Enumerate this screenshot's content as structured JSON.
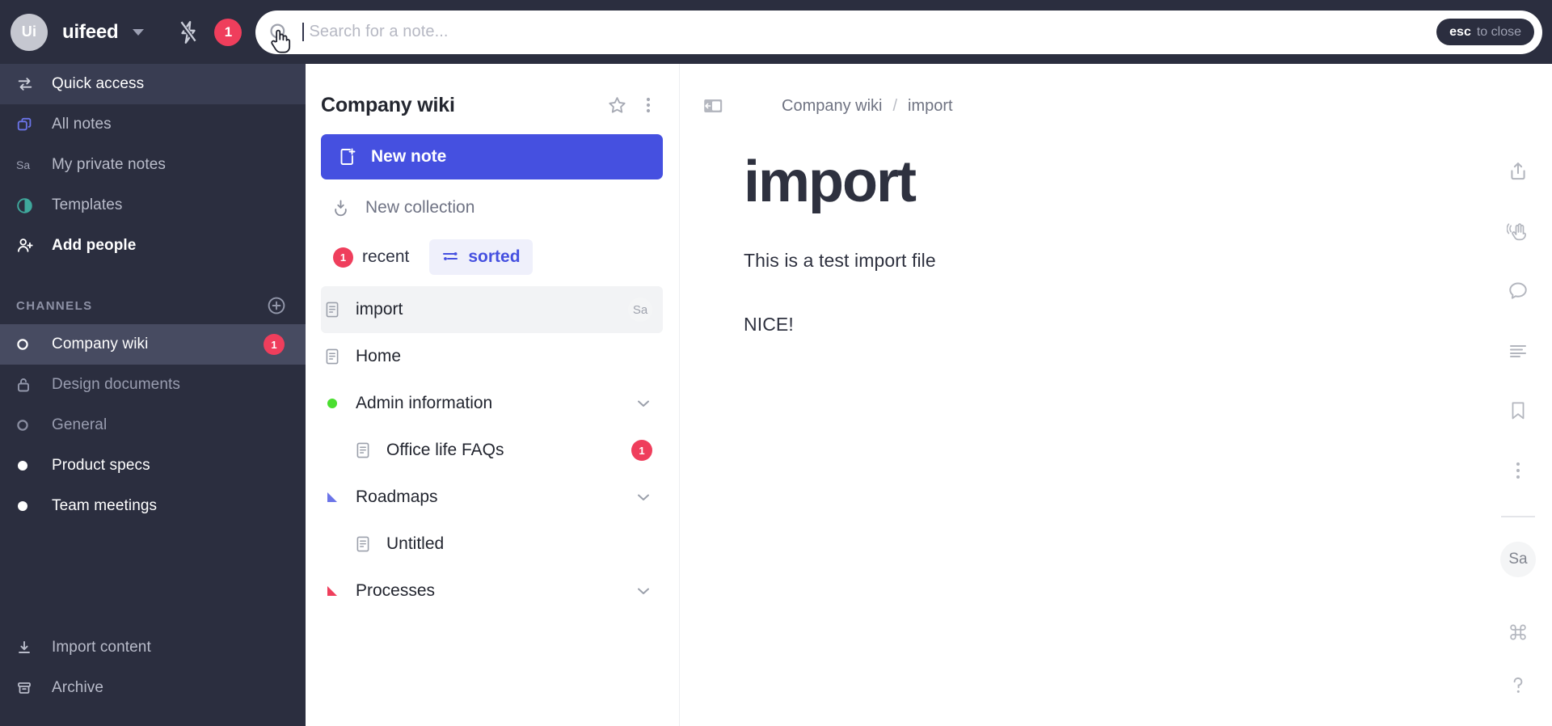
{
  "topbar": {
    "avatar_initials": "Ui",
    "workspace": "uifeed",
    "notification_count": "1",
    "search_placeholder": "Search for a note...",
    "esc_key": "esc",
    "esc_text": "to close",
    "icons": {
      "bolt": "bolt-icon",
      "caret": "chevron-down-icon",
      "search": "search-icon"
    }
  },
  "sidebar": {
    "quick": [
      {
        "label": "Quick access",
        "icon": "swap-arrows-icon",
        "active": true
      },
      {
        "label": "All notes",
        "icon": "layers-icon",
        "active": false
      },
      {
        "label": "My private notes",
        "icon": "avatar-sa-icon",
        "active": false
      },
      {
        "label": "Templates",
        "icon": "template-circle-icon",
        "active": false
      },
      {
        "label": "Add people",
        "icon": "person-add-icon",
        "active": false
      }
    ],
    "channels_header": "CHANNELS",
    "add_channel_icon": "plus-circle-icon",
    "channels": [
      {
        "label": "Company wiki",
        "icon": "circle-outline-icon",
        "active": true,
        "badge": "1"
      },
      {
        "label": "Design documents",
        "icon": "lock-icon",
        "active": false,
        "badge": ""
      },
      {
        "label": "General",
        "icon": "circle-outline-icon",
        "active": false,
        "badge": ""
      },
      {
        "label": "Product specs",
        "icon": "dot-filled-icon",
        "active": false,
        "badge": ""
      },
      {
        "label": "Team meetings",
        "icon": "dot-filled-icon",
        "active": false,
        "badge": ""
      }
    ],
    "bottom": [
      {
        "label": "Import content",
        "icon": "download-icon"
      },
      {
        "label": "Archive",
        "icon": "archive-icon"
      }
    ]
  },
  "midpanel": {
    "title": "Company wiki",
    "star_icon": "star-icon",
    "more_icon": "more-vertical-icon",
    "new_note_label": "New note",
    "new_note_icon": "new-note-icon",
    "new_collection_label": "New collection",
    "new_collection_icon": "new-collection-icon",
    "filters": [
      {
        "label": "recent",
        "badge": "1",
        "active": false,
        "icon": ""
      },
      {
        "label": "sorted",
        "badge": "",
        "active": true,
        "icon": "sort-icon"
      }
    ],
    "documents": [
      {
        "label": "import",
        "icon": "document-icon",
        "selected": true,
        "avatar": "Sa",
        "badge": "",
        "indent": false,
        "chevron": false
      },
      {
        "label": "Home",
        "icon": "document-icon",
        "selected": false,
        "avatar": "",
        "badge": "",
        "indent": false,
        "chevron": false
      },
      {
        "label": "Admin information",
        "icon": "green-dot-icon",
        "selected": false,
        "avatar": "",
        "badge": "",
        "indent": false,
        "chevron": true
      },
      {
        "label": "Office life FAQs",
        "icon": "document-icon",
        "selected": false,
        "avatar": "",
        "badge": "1",
        "indent": true,
        "chevron": false
      },
      {
        "label": "Roadmaps",
        "icon": "blue-triangle-icon",
        "selected": false,
        "avatar": "",
        "badge": "",
        "indent": false,
        "chevron": true
      },
      {
        "label": "Untitled",
        "icon": "document-icon",
        "selected": false,
        "avatar": "",
        "badge": "",
        "indent": true,
        "chevron": false
      },
      {
        "label": "Processes",
        "icon": "red-triangle-icon",
        "selected": false,
        "avatar": "",
        "badge": "",
        "indent": false,
        "chevron": true
      }
    ]
  },
  "main": {
    "collapse_icon": "collapse-panel-icon",
    "breadcrumb": {
      "parent": "Company wiki",
      "separator": "/",
      "current": "import"
    },
    "doc_title": "import",
    "paragraph_1": "This is a test import file",
    "paragraph_2": "NICE!"
  },
  "right_toolbar": {
    "icons": [
      "share-icon",
      "wave-hand-icon",
      "comment-icon",
      "outline-icon",
      "bookmark-icon",
      "more-vertical-icon"
    ],
    "avatar": "Sa",
    "bottom_icons": [
      "command-key-icon",
      "help-question-icon"
    ]
  },
  "colors": {
    "sidebar_bg": "#2b2e3f",
    "accent_blue": "#4550e0",
    "badge_red": "#ef3e5c",
    "green_dot": "#4ade2f",
    "red_triangle": "#ef3e5c"
  }
}
